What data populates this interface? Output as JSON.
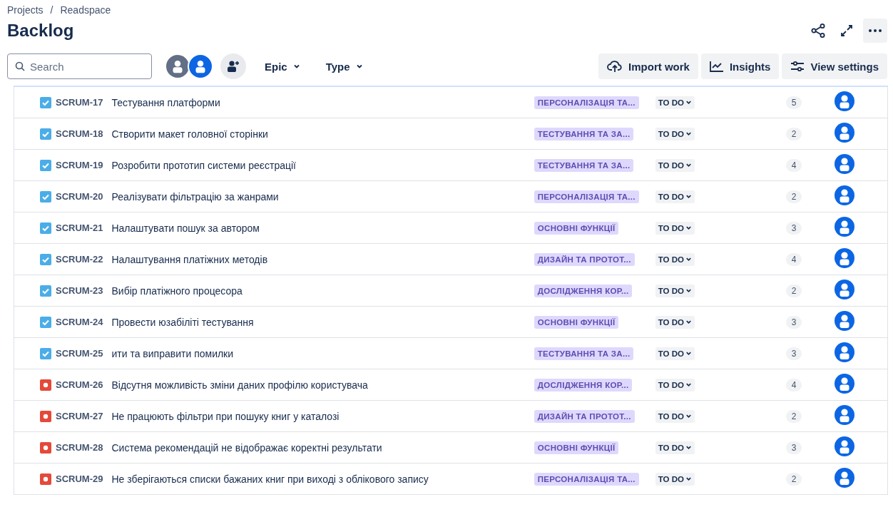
{
  "breadcrumbs": [
    "Projects",
    "Readspace"
  ],
  "breadcrumb_separator": "/",
  "title": "Backlog",
  "search": {
    "placeholder": "Search"
  },
  "avatars": [
    {
      "color": "#626f86"
    },
    {
      "color": "#0c66e4"
    }
  ],
  "filters": [
    "Epic",
    "Type"
  ],
  "actions": [
    "Import work",
    "Insights",
    "View settings"
  ],
  "rows": [
    {
      "kind": "story",
      "key": "SCRUM-17",
      "summary": "Тестування платформи",
      "epic": "ПЕРСОНАЛІЗАЦІЯ ТА...",
      "status": "TO DO",
      "points": "5"
    },
    {
      "kind": "story",
      "key": "SCRUM-18",
      "summary": "Створити макет головної сторінки",
      "epic": "ТЕСТУВАННЯ ТА ЗА...",
      "status": "TO DO",
      "points": "2"
    },
    {
      "kind": "story",
      "key": "SCRUM-19",
      "summary": "Розробити прототип системи реєстрації",
      "epic": "ТЕСТУВАННЯ ТА ЗА...",
      "status": "TO DO",
      "points": "4"
    },
    {
      "kind": "story",
      "key": "SCRUM-20",
      "summary": "Реалізувати фільтрацію за жанрами",
      "epic": "ПЕРСОНАЛІЗАЦІЯ ТА...",
      "status": "TO DO",
      "points": "2"
    },
    {
      "kind": "story",
      "key": "SCRUM-21",
      "summary": "Налаштувати пошук за автором",
      "epic": "ОСНОВНІ ФУНКЦІЇ",
      "status": "TO DO",
      "points": "3"
    },
    {
      "kind": "story",
      "key": "SCRUM-22",
      "summary": "Налаштування платіжних методів",
      "epic": "ДИЗАЙН ТА ПРОТОТ...",
      "status": "TO DO",
      "points": "4"
    },
    {
      "kind": "story",
      "key": "SCRUM-23",
      "summary": "Вибір платіжного процесора",
      "epic": "ДОСЛІДЖЕННЯ КОР...",
      "status": "TO DO",
      "points": "2"
    },
    {
      "kind": "story",
      "key": "SCRUM-24",
      "summary": "Провести юзабіліті тестування",
      "epic": "ОСНОВНІ ФУНКЦІЇ",
      "status": "TO DO",
      "points": "3"
    },
    {
      "kind": "story",
      "key": "SCRUM-25",
      "summary": "ити та виправити помилки",
      "epic": "ТЕСТУВАННЯ ТА ЗА...",
      "status": "TO DO",
      "points": "3"
    },
    {
      "kind": "bug",
      "key": "SCRUM-26",
      "summary": "Відсутня можливість зміни даних профілю користувача",
      "epic": "ДОСЛІДЖЕННЯ КОР...",
      "status": "TO DO",
      "points": "4"
    },
    {
      "kind": "bug",
      "key": "SCRUM-27",
      "summary": "Не працюють фільтри при пошуку книг у каталозі",
      "epic": "ДИЗАЙН ТА ПРОТОТ...",
      "status": "TO DO",
      "points": "2"
    },
    {
      "kind": "bug",
      "key": "SCRUM-28",
      "summary": "Система рекомендацій не відображає коректні результати",
      "epic": "ОСНОВНІ ФУНКЦІЇ",
      "status": "TO DO",
      "points": "3"
    },
    {
      "kind": "bug",
      "key": "SCRUM-29",
      "summary": "Не зберігаються списки бажаних книг при виході з облікового запису",
      "epic": "ПЕРСОНАЛІЗАЦІЯ ТА...",
      "status": "TO DO",
      "points": "2"
    }
  ]
}
